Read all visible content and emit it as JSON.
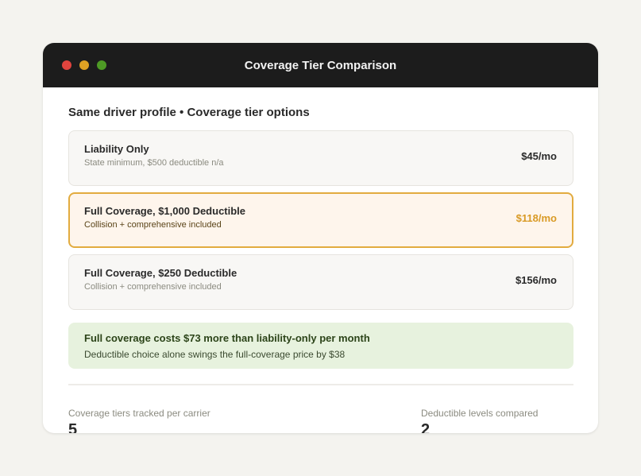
{
  "window": {
    "title": "Coverage Tier Comparison"
  },
  "header": {
    "subtitle": "Same driver profile • Coverage tier options"
  },
  "tiers": [
    {
      "name": "Liability Only",
      "description": "State minimum, $500 deductible n/a",
      "price": "$45/mo",
      "selected": false
    },
    {
      "name": "Full Coverage, $1,000 Deductible",
      "description": "Collision + comprehensive included",
      "price": "$118/mo",
      "selected": true
    },
    {
      "name": "Full Coverage, $250 Deductible",
      "description": "Collision + comprehensive included",
      "price": "$156/mo",
      "selected": false
    }
  ],
  "callout": {
    "headline": "Full coverage costs $73 more than liability-only per month",
    "detail": "Deductible choice alone swings the full-coverage price by $38"
  },
  "stats": [
    {
      "label": "Coverage tiers tracked per carrier",
      "value": "5"
    },
    {
      "label": "Deductible levels compared",
      "value": "2"
    }
  ],
  "colors": {
    "titlebar": "#1c1c1c",
    "accent": "#e2ab3f",
    "callout_bg": "#e7f2de",
    "close": "#e0443e",
    "minimize": "#dea123",
    "maximize": "#4e9a25"
  }
}
